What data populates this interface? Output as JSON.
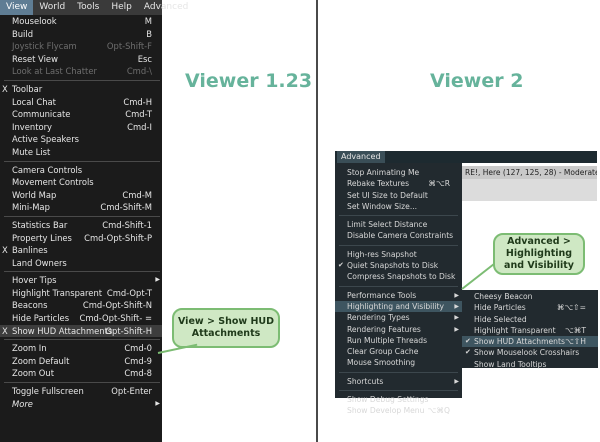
{
  "viewer1": {
    "title": "Viewer 1.23",
    "menubar": [
      "View",
      "World",
      "Tools",
      "Help",
      "Advanced"
    ],
    "items": [
      {
        "label": "Mouselook",
        "shortcut": "M"
      },
      {
        "label": "Build",
        "shortcut": "B"
      },
      {
        "label": "Joystick Flycam",
        "shortcut": "Opt-Shift-F",
        "disabled": true
      },
      {
        "label": "Reset View",
        "shortcut": "Esc"
      },
      {
        "label": "Look at Last Chatter",
        "shortcut": "Cmd-\\",
        "disabled": true
      },
      {
        "sep": true
      },
      {
        "label": "Toolbar",
        "check": "X"
      },
      {
        "label": "Local Chat",
        "shortcut": "Cmd-H"
      },
      {
        "label": "Communicate",
        "shortcut": "Cmd-T"
      },
      {
        "label": "Inventory",
        "shortcut": "Cmd-I"
      },
      {
        "label": "Active Speakers"
      },
      {
        "label": "Mute List"
      },
      {
        "sep": true
      },
      {
        "label": "Camera Controls"
      },
      {
        "label": "Movement Controls"
      },
      {
        "label": "World Map",
        "shortcut": "Cmd-M"
      },
      {
        "label": "Mini-Map",
        "shortcut": "Cmd-Shift-M"
      },
      {
        "sep": true
      },
      {
        "label": "Statistics Bar",
        "shortcut": "Cmd-Shift-1"
      },
      {
        "label": "Property Lines",
        "shortcut": "Cmd-Opt-Shift-P"
      },
      {
        "label": "Banlines",
        "check": "X"
      },
      {
        "label": "Land Owners"
      },
      {
        "sep": true
      },
      {
        "label": "Hover Tips",
        "arrow": true
      },
      {
        "label": "Highlight Transparent",
        "shortcut": "Cmd-Opt-T"
      },
      {
        "label": "Beacons",
        "shortcut": "Cmd-Opt-Shift-N"
      },
      {
        "label": "Hide Particles",
        "shortcut": "Cmd-Opt-Shift- ="
      },
      {
        "label": "Show HUD Attachments",
        "shortcut": "Opt-Shift-H",
        "check": "X",
        "highlight": true
      },
      {
        "sep": true
      },
      {
        "label": "Zoom In",
        "shortcut": "Cmd-0"
      },
      {
        "label": "Zoom Default",
        "shortcut": "Cmd-9"
      },
      {
        "label": "Zoom Out",
        "shortcut": "Cmd-8"
      },
      {
        "sep": true
      },
      {
        "label": "Toggle Fullscreen",
        "shortcut": "Opt-Enter"
      },
      {
        "label": "More",
        "italic": true,
        "arrow": true
      }
    ],
    "callout": "View > Show HUD Attachments"
  },
  "viewer2": {
    "title": "Viewer 2",
    "menu_tab": "Advanced",
    "status_bar": "RE!, Here (127, 125, 28) - Moderate",
    "items": [
      {
        "label": "Stop Animating Me"
      },
      {
        "label": "Rebake Textures",
        "shortcut": "⌘⌥R"
      },
      {
        "label": "Set UI Size to Default"
      },
      {
        "label": "Set Window Size..."
      },
      {
        "sep": true
      },
      {
        "label": "Limit Select Distance"
      },
      {
        "label": "Disable Camera Constraints"
      },
      {
        "sep": true
      },
      {
        "label": "High-res Snapshot"
      },
      {
        "label": "Quiet Snapshots to Disk",
        "check": "✔"
      },
      {
        "label": "Compress Snapshots to Disk"
      },
      {
        "sep": true
      },
      {
        "label": "Performance Tools",
        "arrow": true
      },
      {
        "label": "Highlighting and Visibility",
        "arrow": true,
        "highlight": true
      },
      {
        "label": "Rendering Types",
        "arrow": true
      },
      {
        "label": "Rendering Features",
        "arrow": true
      },
      {
        "label": "Run Multiple Threads"
      },
      {
        "label": "Clear Group Cache"
      },
      {
        "label": "Mouse Smoothing"
      },
      {
        "sep": true
      },
      {
        "label": "Shortcuts",
        "arrow": true
      },
      {
        "sep": true
      },
      {
        "label": "Show Debug Settings"
      },
      {
        "label": "Show Develop Menu",
        "shortcut": "⌥⌘Q"
      }
    ],
    "submenu": [
      {
        "label": "Cheesy Beacon"
      },
      {
        "label": "Hide Particles",
        "shortcut": "⌘⌥⇧="
      },
      {
        "label": "Hide Selected"
      },
      {
        "label": "Highlight Transparent",
        "shortcut": "⌥⌘T"
      },
      {
        "label": "Show HUD Attachments",
        "shortcut": "⌥⇧H",
        "check": "✔",
        "highlight": true
      },
      {
        "label": "Show Mouselook Crosshairs",
        "check": "✔"
      },
      {
        "label": "Show Land Tooltips"
      }
    ],
    "callout": "Advanced > Highlighting and Visibility"
  }
}
